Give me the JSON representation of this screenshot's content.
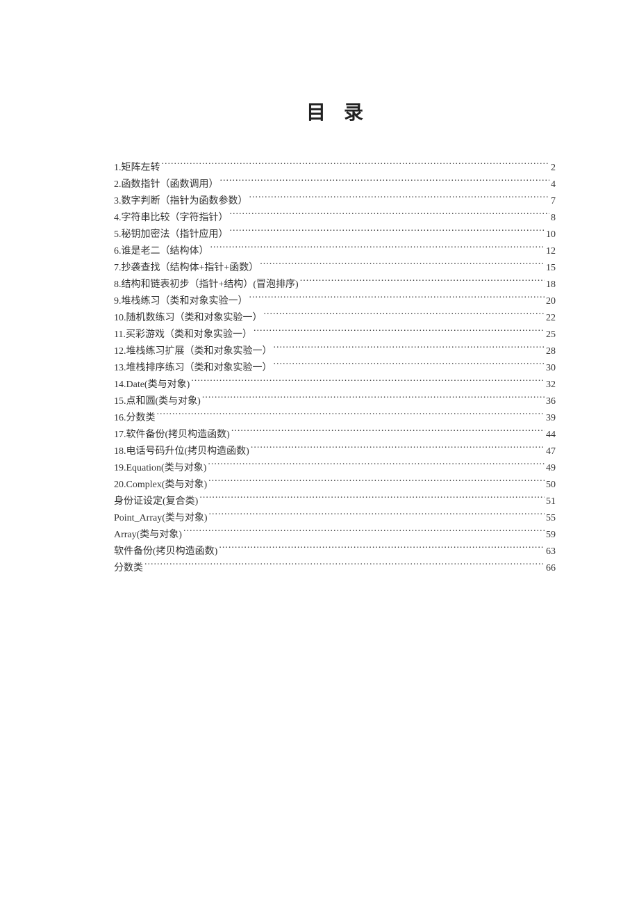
{
  "title": "目录",
  "entries": [
    {
      "label": "1.矩阵左转",
      "page": "2"
    },
    {
      "label": "2.函数指针（函数调用）",
      "page": "4"
    },
    {
      "label": "3.数字判断（指针为函数参数）",
      "page": "7"
    },
    {
      "label": "4.字符串比较（字符指针）",
      "page": "8"
    },
    {
      "label": "5.秘钥加密法（指针应用）",
      "page": "10"
    },
    {
      "label": "6.谁是老二（结构体）",
      "page": "12"
    },
    {
      "label": "7.抄袭查找（结构体+指针+函数）",
      "page": "15"
    },
    {
      "label": "8.结构和链表初步（指针+结构）(冒泡排序)",
      "page": "18"
    },
    {
      "label": "9.堆栈练习（类和对象实验一）",
      "page": "20"
    },
    {
      "label": "10.随机数练习（类和对象实验一）",
      "page": "22"
    },
    {
      "label": "11.买彩游戏（类和对象实验一）",
      "page": "25"
    },
    {
      "label": "12.堆栈练习扩展（类和对象实验一）",
      "page": "28"
    },
    {
      "label": "13.堆栈排序练习（类和对象实验一）",
      "page": "30"
    },
    {
      "label": "14.Date(类与对象)",
      "page": "32"
    },
    {
      "label": "15.点和圆(类与对象)",
      "page": "36"
    },
    {
      "label": "16.分数类",
      "page": "39"
    },
    {
      "label": "17.软件备份(拷贝构造函数)",
      "page": "44"
    },
    {
      "label": "18.电话号码升位(拷贝构造函数)",
      "page": "47"
    },
    {
      "label": "19.Equation(类与对象)",
      "page": "49"
    },
    {
      "label": "20.Complex(类与对象)",
      "page": "50"
    },
    {
      "label": "身份证设定(复合类)",
      "page": "51"
    },
    {
      "label": "Point_Array(类与对象)",
      "page": "55"
    },
    {
      "label": "Array(类与对象)",
      "page": "59"
    },
    {
      "label": "软件备份(拷贝构造函数)",
      "page": "63"
    },
    {
      "label": "分数类",
      "page": "66"
    }
  ]
}
